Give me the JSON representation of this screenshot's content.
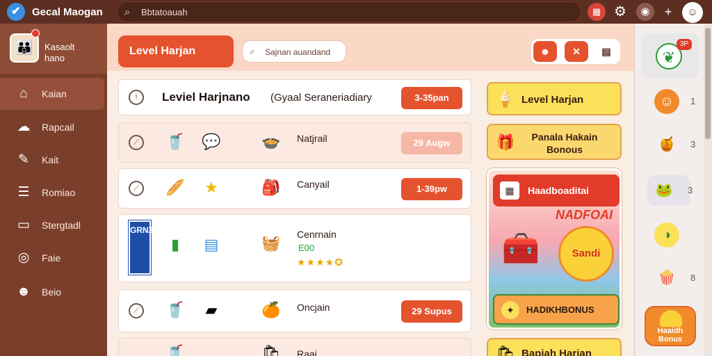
{
  "app": {
    "title": "Gecal Maogan",
    "logo_icon": "check-icon"
  },
  "top_search": {
    "placeholder": "Bbtatoauah"
  },
  "top_actions": [
    "game-icon",
    "gear-icon",
    "robot-icon",
    "plus-icon",
    "avatar-icon"
  ],
  "profile": {
    "name_line1": "Kasaolt",
    "name_line2": "hano"
  },
  "sidebar": {
    "items": [
      {
        "label": "Kaian",
        "icon": "home-icon"
      },
      {
        "label": "Rapcail",
        "icon": "cloud-icon"
      },
      {
        "label": "Kait",
        "icon": "edit-icon"
      },
      {
        "label": "Romiao",
        "icon": "list-icon"
      },
      {
        "label": "Stergtadl",
        "icon": "folder-icon"
      },
      {
        "label": "Faie",
        "icon": "location-icon"
      },
      {
        "label": "Beio",
        "icon": "user-icon"
      }
    ]
  },
  "header": {
    "title": "Level Harjan",
    "search_placeholder": "Sajnan auandand"
  },
  "list": {
    "title_row": {
      "title": "Leviel Harjnano",
      "subtitle": "(Gyaal Seraneriadiary",
      "pill": "3-35pan"
    },
    "rows": [
      {
        "name": "Natjrail",
        "pill": "29 Augw"
      },
      {
        "name": "Canyail",
        "pill": "1-39pw"
      },
      {
        "name": "Cenrnain",
        "price": "E00",
        "rating": "★★★★✪",
        "code": "GRNZ"
      },
      {
        "name": "Oncjain",
        "pill": "29 Supus"
      },
      {
        "name": "Raai"
      }
    ]
  },
  "rewards": {
    "card1": "Level Harjan",
    "card2": "Panala Hakain Bonous",
    "promo_bubble": "Haadboaditai",
    "promo_burst_top": "NADFOAI",
    "promo_burst": "Sandi",
    "promo_button": "HADIKHBONUS",
    "card3": "Bapiah Harjan"
  },
  "rail": {
    "badge": "3P",
    "items": [
      {
        "num": "1"
      },
      {
        "num": "3"
      },
      {
        "num": "3"
      },
      {
        "num": ""
      },
      {
        "num": "8"
      }
    ],
    "bottom_label1": "Haaidh",
    "bottom_label2": "Bonus"
  }
}
